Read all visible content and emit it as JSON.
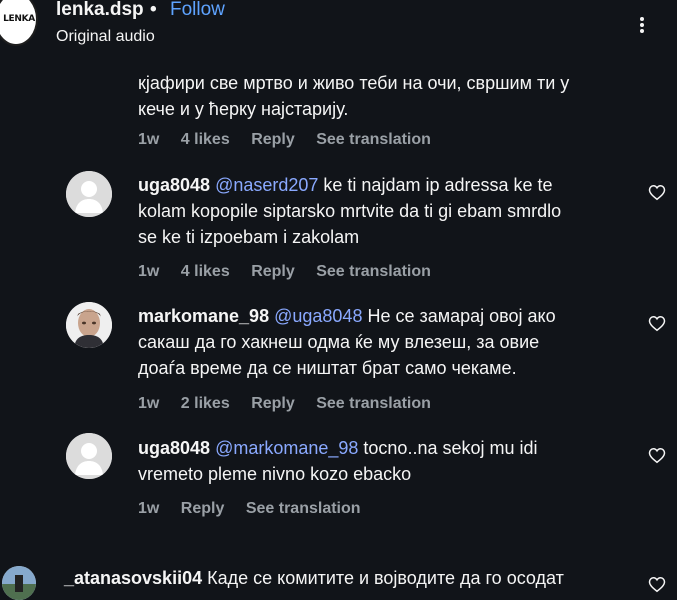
{
  "header": {
    "logo_text": "LENKA",
    "username": "lenka.dsp",
    "separator": "•",
    "follow_label": "Follow",
    "audio_label": "Original audio"
  },
  "comments": [
    {
      "lines": [
        "кјафири све мртво и живо теби на очи, свршим ти у",
        "кече и у ћерку најстарију."
      ],
      "meta": {
        "age": "1w",
        "likes": "4 likes",
        "reply": "Reply",
        "translate": "See translation"
      }
    },
    {
      "username": "uga8048",
      "mention": "@naserd207",
      "line1_rest": " ke ti najdam ip adressa ke te",
      "lines": [
        "kolam kopopile siptarsko mrtvite da ti gi ebam smrdlo",
        "se ke ti izpoebam i zakolam"
      ],
      "meta": {
        "age": "1w",
        "likes": "4 likes",
        "reply": "Reply",
        "translate": "See translation"
      }
    },
    {
      "username": "markomane_98",
      "mention": "@uga8048",
      "line1_rest": " Не се замарај овој ако",
      "lines": [
        "сакаш да го хакнеш одма ќе му влезеш, за овие",
        "доаѓа време да се ништат брат само чекаме."
      ],
      "meta": {
        "age": "1w",
        "likes": "2 likes",
        "reply": "Reply",
        "translate": "See translation"
      }
    },
    {
      "username": "uga8048",
      "mention": "@markomane_98",
      "line1_rest": " tocno..na sekoj mu idi",
      "lines": [
        "vremeto pleme nivno kozo ebacko"
      ],
      "meta": {
        "age": "1w",
        "reply": "Reply",
        "translate": "See translation"
      }
    },
    {
      "username": "_atanasovskii04",
      "line1_rest": " Каде се комитите и војводите да го осодат"
    }
  ],
  "colors": {
    "background": "#111419",
    "text": "#f5f5f5",
    "secondary_text": "#9aa0a6",
    "mention": "#8aa9ff",
    "follow": "#5ea3ff"
  },
  "icons": {
    "more": "more-vertical-icon",
    "like": "heart-outline-icon",
    "default_avatar": "default-user-avatar-icon"
  }
}
